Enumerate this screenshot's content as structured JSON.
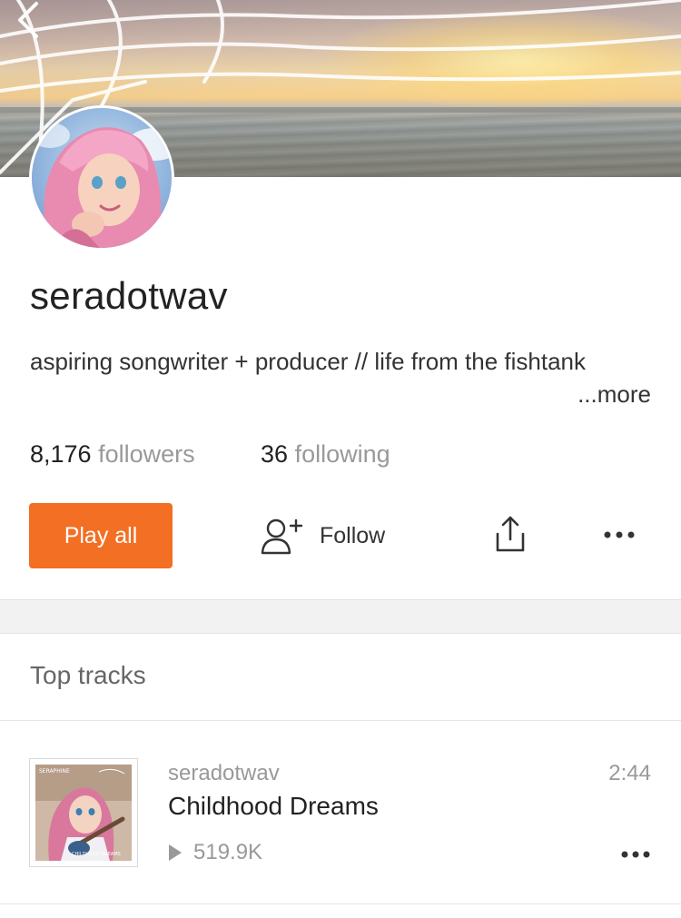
{
  "profile": {
    "username": "seradotwav",
    "bio": "aspiring songwriter + producer // life from the fishtank",
    "bio_more": "...more",
    "followers_count": "8,176",
    "followers_label": "followers",
    "following_count": "36",
    "following_label": "following"
  },
  "actions": {
    "play_all_label": "Play all",
    "follow_label": "Follow"
  },
  "top_tracks": {
    "section_title": "Top tracks",
    "items": [
      {
        "artist": "seradotwav",
        "title": "Childhood Dreams",
        "plays": "519.9K",
        "duration": "2:44",
        "cover_top_text": "SERAPHINE",
        "cover_bottom_text": "CHILDHOOD DREAMS"
      }
    ]
  },
  "colors": {
    "accent": "#f26f23",
    "text_primary": "#222222",
    "text_secondary": "#999999",
    "separator_band": "#f2f2f2"
  },
  "icons": {
    "back": "chevron-left-icon",
    "follow": "add-user-icon",
    "share": "share-icon",
    "more": "more-horizontal-icon",
    "play": "play-triangle-icon"
  }
}
